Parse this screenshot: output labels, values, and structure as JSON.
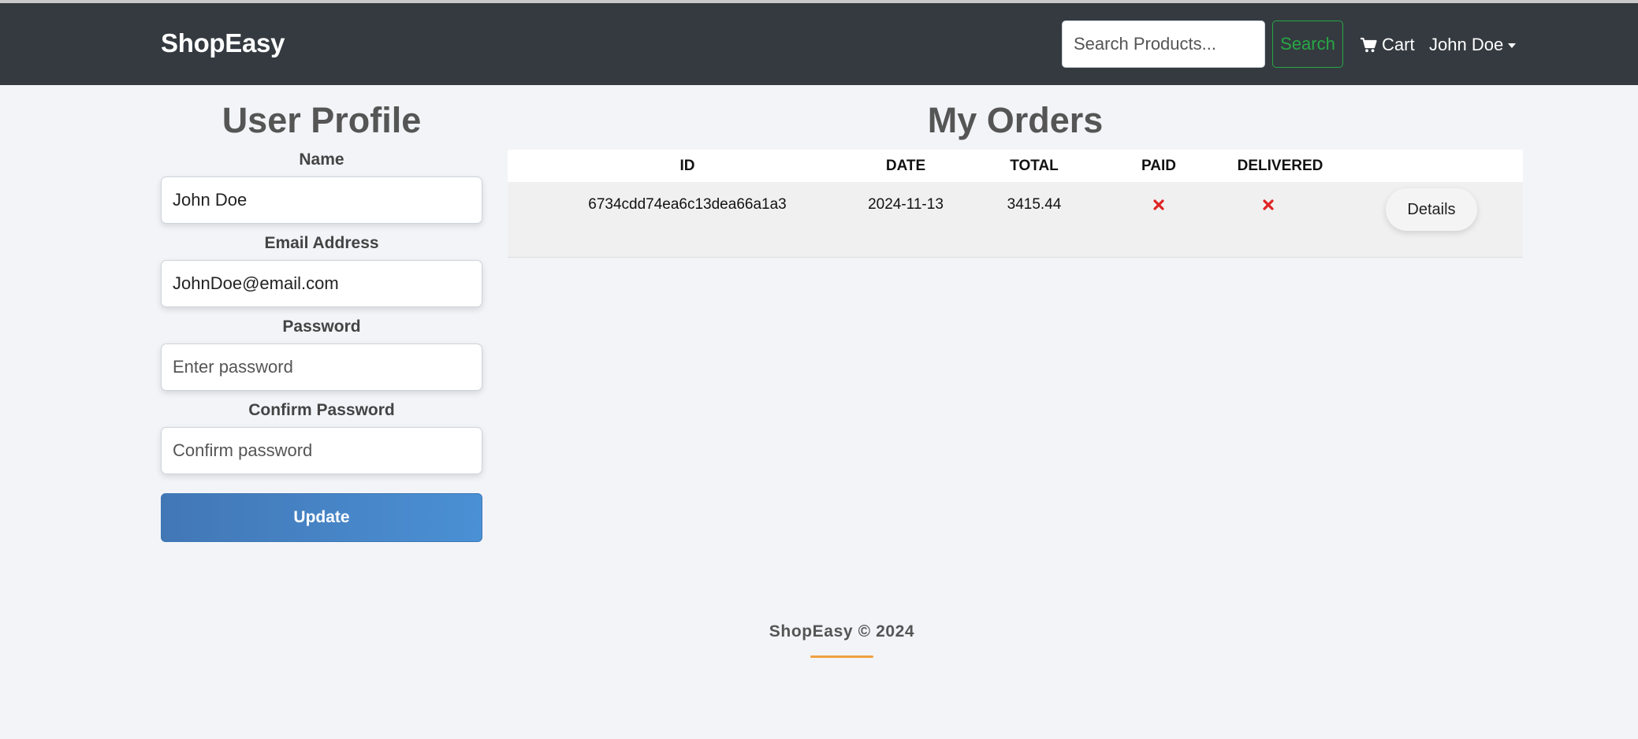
{
  "navbar": {
    "brand": "ShopEasy",
    "search_placeholder": "Search Products...",
    "search_label": "Search",
    "cart_label": "Cart",
    "user_name": "John Doe"
  },
  "profile": {
    "title": "User Profile",
    "name_label": "Name",
    "name_value": "John Doe",
    "email_label": "Email Address",
    "email_value": "JohnDoe@email.com",
    "password_label": "Password",
    "password_placeholder": "Enter password",
    "confirm_label": "Confirm Password",
    "confirm_placeholder": "Confirm password",
    "update_label": "Update"
  },
  "orders": {
    "title": "My Orders",
    "columns": [
      "ID",
      "DATE",
      "TOTAL",
      "PAID",
      "DELIVERED"
    ],
    "rows": [
      {
        "id": "6734cdd74ea6c13dea66a1a3",
        "date": "2024-11-13",
        "total": "3415.44",
        "paid_icon": "times-icon",
        "delivered_icon": "times-icon",
        "details_label": "Details"
      }
    ]
  },
  "footer": {
    "text": "ShopEasy © 2024"
  },
  "colors": {
    "navbar_bg": "#343a40",
    "search_accent": "#28a745",
    "update_button": "#4a90d4",
    "status_no": "#e02424",
    "footer_accent": "#f0a040"
  }
}
